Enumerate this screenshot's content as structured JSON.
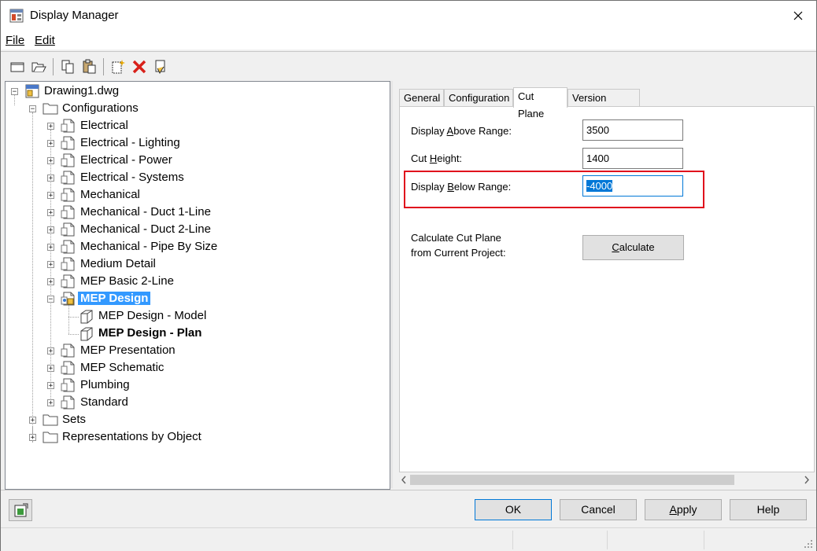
{
  "window": {
    "title": "Display Manager"
  },
  "menu": {
    "file": "File",
    "edit": "Edit"
  },
  "toolbar": {
    "icons": [
      "new-icon",
      "open-icon",
      "copy-icon",
      "paste-icon",
      "new-item-icon",
      "delete-icon",
      "purge-icon"
    ]
  },
  "tree": {
    "root": "Drawing1.dwg",
    "configurations": "Configurations",
    "items": [
      "Electrical",
      "Electrical - Lighting",
      "Electrical - Power",
      "Electrical - Systems",
      "Mechanical",
      "Mechanical - Duct 1-Line",
      "Mechanical - Duct 2-Line",
      "Mechanical - Pipe By Size",
      "Medium Detail",
      "MEP Basic 2-Line",
      "MEP Design",
      "MEP Presentation",
      "MEP Schematic",
      "Plumbing",
      "Standard"
    ],
    "mep_design_children": [
      "MEP Design - Model",
      "MEP Design - Plan"
    ],
    "sets": "Sets",
    "representations": "Representations by Object"
  },
  "tabs": [
    "General",
    "Configuration",
    "Cut Plane",
    "Version History"
  ],
  "active_tab": "Cut Plane",
  "cut_plane": {
    "above_label_pre": "Display ",
    "above_label_u": "A",
    "above_label_post": "bove Range:",
    "above_value": "3500",
    "cut_label_pre": "Cut ",
    "cut_label_u": "H",
    "cut_label_post": "eight:",
    "cut_value": "1400",
    "below_label_pre": "Display ",
    "below_label_u": "B",
    "below_label_post": "elow Range:",
    "below_value": "-4000",
    "calc_label_line1": "Calculate Cut Plane",
    "calc_label_line2": "from Current Project:",
    "calc_button_u": "C",
    "calc_button_rest": "alculate"
  },
  "buttons": {
    "ok": "OK",
    "cancel": "Cancel",
    "apply_u": "A",
    "apply_rest": "pply",
    "help": "Help"
  },
  "colors": {
    "highlight": "#e00b1c",
    "selection": "#3399ff",
    "focus": "#0078d7"
  }
}
